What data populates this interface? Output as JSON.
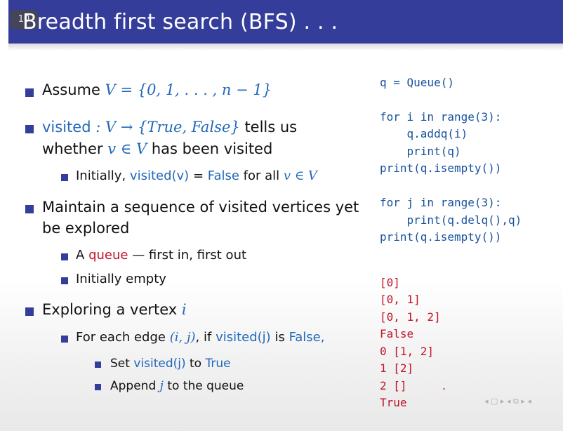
{
  "slide": {
    "number": "10",
    "title": "Breadth first search (BFS) . . .",
    "bullets": {
      "b1_text": "Assume",
      "b1_math": "V = {0, 1, . . . , n − 1}",
      "b2_term": "visited",
      "b2_math": ": V → {True, False}",
      "b2_text": "tells us",
      "b2_line2_a": "whether",
      "b2_line2_math": "v ∈ V",
      "b2_line2_b": "has been visited",
      "b2_sub_a": "Initially,",
      "b2_sub_term": "visited(v)",
      "b2_sub_eq": " = ",
      "b2_sub_false": "False",
      "b2_sub_b": "for all",
      "b2_sub_math": "v ∈ V",
      "b3_line1": "Maintain a sequence of visited vertices yet",
      "b3_line2": "be explored",
      "b3_sub1_a": "A",
      "b3_sub1_term": "queue",
      "b3_sub1_b": "— first in, first out",
      "b3_sub2": "Initially empty",
      "b4_text": "Exploring a vertex",
      "b4_math": "i",
      "b4_sub_a": "For each edge",
      "b4_sub_math": "(i, j)",
      "b4_sub_b": ", if",
      "b4_sub_term": "visited(j)",
      "b4_sub_c": "is",
      "b4_sub_false": "False,",
      "b4_subsub1_a": "Set",
      "b4_subsub1_term": "visited(j)",
      "b4_subsub1_b": "to",
      "b4_subsub1_true": "True",
      "b4_subsub2_a": "Append",
      "b4_subsub2_math": "j",
      "b4_subsub2_b": "to the queue"
    },
    "code": [
      "q = Queue()",
      "",
      "for i in range(3):",
      "    q.addq(i)",
      "    print(q)",
      "print(q.isempty())",
      "",
      "for j in range(3):",
      "    print(q.delq(),q)",
      "print(q.isempty())"
    ],
    "output": [
      "[0]",
      "[0, 1]",
      "[0, 1, 2]",
      "False",
      "0 [1, 2]",
      "1 [2]",
      "2 []",
      "True"
    ],
    "nav_symbols": "◂ ▢ ▸ ◂ ⧉ ▸ ◂"
  }
}
